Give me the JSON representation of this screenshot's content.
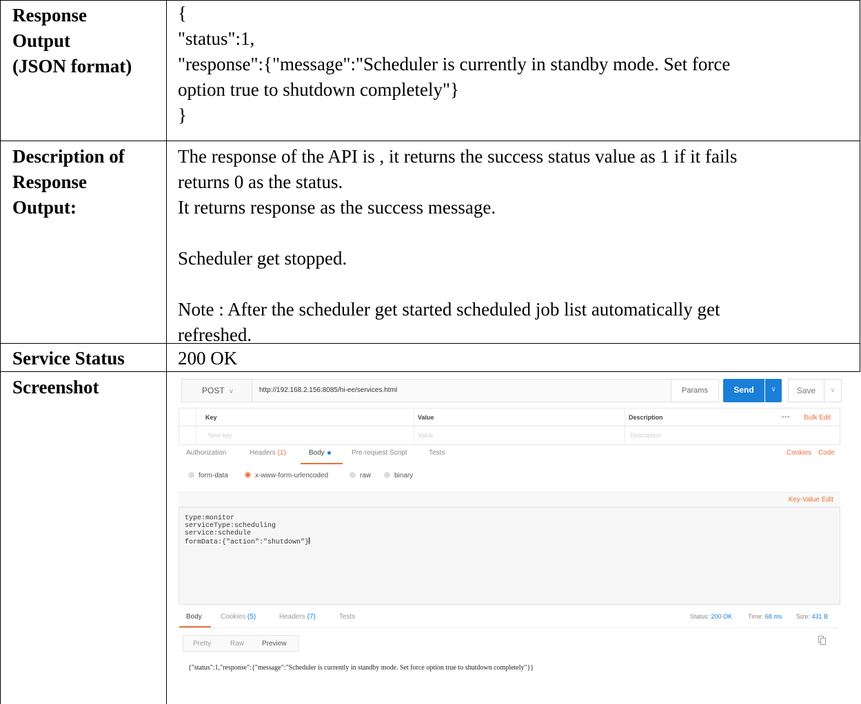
{
  "rows": [
    {
      "label": "Response Output (JSON format)",
      "lines": [
        "{",
        "\"status\":1,",
        "\"response\":{\"message\":\"Scheduler is currently in standby mode. Set force",
        "option true to shutdown completely\"}",
        "}"
      ]
    },
    {
      "label": "Description of Response Output:",
      "lines": [
        "The response of the API is , it returns the success status value as 1 if it fails",
        "returns 0 as the status.",
        "It returns response as the success message.",
        "",
        "Scheduler get stopped.",
        "",
        "Note : After the scheduler get started scheduled job list automatically get",
        "refreshed."
      ]
    },
    {
      "label": "Service Status",
      "lines": [
        "200 OK"
      ]
    },
    {
      "label": "Screenshot",
      "lines": []
    }
  ],
  "labels": {
    "r0a": "Response",
    "r0b": "Output",
    "r0c": "(JSON format)",
    "r1a": "Description of",
    "r1b": "Response",
    "r1c": "Output:",
    "r2": "Service Status",
    "r3": "Screenshot"
  },
  "postman": {
    "method": "POST",
    "url": "http://192.168.2.156:8085/hi-ee/services.html",
    "params_label": "Params",
    "send_label": "Send",
    "save_label": "Save",
    "kv_headers": {
      "key": "Key",
      "value": "Value",
      "description": "Description",
      "more": "•••",
      "bulk_edit": "Bulk Edit"
    },
    "kv_placeholders": {
      "key": "New key",
      "value": "Value",
      "description": "Description"
    },
    "request_tabs": {
      "authorization": "Authorization",
      "headers": "Headers",
      "headers_count": "(1)",
      "body": "Body",
      "prerequest": "Pre-request Script",
      "tests": "Tests"
    },
    "cookies_link": "Cookies",
    "code_link": "Code",
    "body_types": {
      "form_data": "form-data",
      "urlencoded": "x-www-form-urlencoded",
      "raw": "raw",
      "binary": "binary"
    },
    "selected_body_type": "x-www-form-urlencoded",
    "key_value_edit": "Key-Value Edit",
    "body_text": "type:monitor\nserviceType:scheduling\nservice:schedule\nformData:{\"action\":\"shutdown\"}",
    "response_tabs": {
      "body": "Body",
      "cookies": "Cookies",
      "cookies_count": "(5)",
      "headers": "Headers",
      "headers_count": "(7)",
      "tests": "Tests"
    },
    "status_label": "Status:",
    "status_value": "200 OK",
    "time_label": "Time:",
    "time_value": "68 ms",
    "size_label": "Size:",
    "size_value": "431 B",
    "view_modes": {
      "pretty": "Pretty",
      "raw": "Raw",
      "preview": "Preview"
    },
    "active_view": "Preview",
    "response_body": "{\"status\":1,\"response\":{\"message\":\"Scheduler is currently in standby mode. Set force option true to shutdown completely\"}}",
    "accent_color": "#e8703a",
    "send_color": "#1a7fd8"
  }
}
